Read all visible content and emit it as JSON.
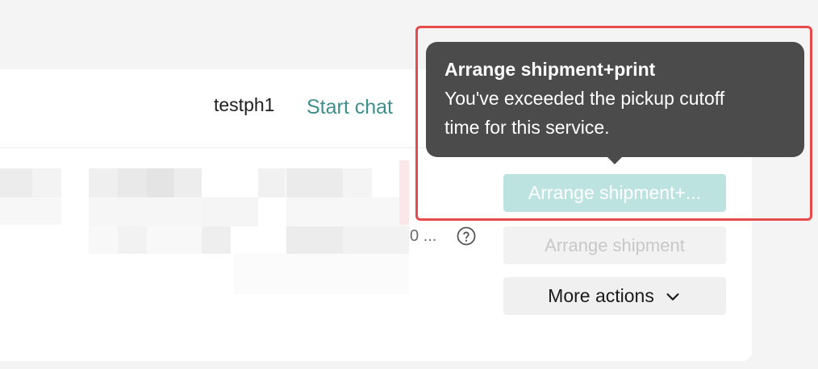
{
  "header": {
    "username": "testph1",
    "start_chat_label": "Start chat"
  },
  "order": {
    "meta_text": "0 ...",
    "help_icon": "question-circle-icon"
  },
  "actions": {
    "arrange_print_label": "Arrange shipment+...",
    "arrange_label": "Arrange shipment",
    "more_label": "More actions",
    "more_icon": "chevron-down-icon"
  },
  "tooltip": {
    "title": "Arrange shipment+print",
    "line1": "You've exceeded the pickup cutoff",
    "line2": "time for this service."
  },
  "colors": {
    "accent": "#3f8f8d",
    "primary_disabled": "#bde3e0",
    "tooltip_bg": "#4b4b4b",
    "highlight": "#e64a4a"
  }
}
